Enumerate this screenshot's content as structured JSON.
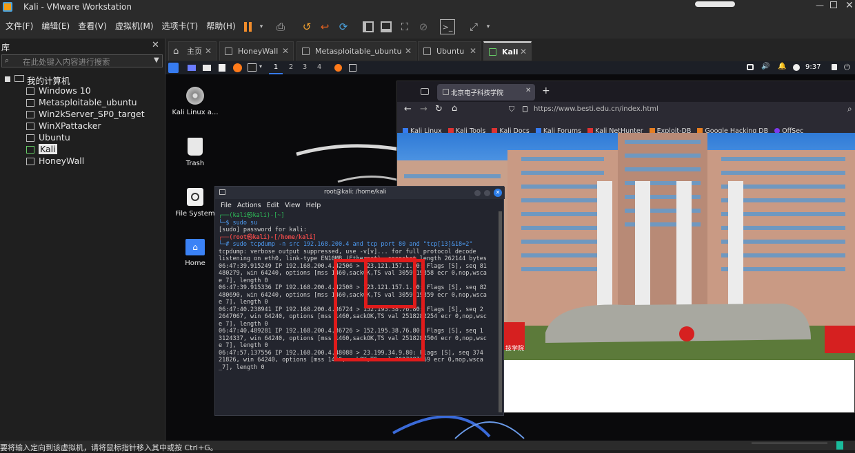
{
  "window": {
    "title": "Kali - VMware Workstation"
  },
  "menu": [
    "文件(F)",
    "编辑(E)",
    "查看(V)",
    "虚拟机(M)",
    "选项卡(T)",
    "帮助(H)"
  ],
  "library": {
    "title": "库",
    "search_placeholder": "在此处键入内容进行搜索",
    "root": "我的计算机",
    "items": [
      "Windows 10",
      "Metasploitable_ubuntu",
      "Win2kServer_SP0_target",
      "WinXPattacker",
      "Ubuntu",
      "Kali",
      "HoneyWall"
    ],
    "selected": "Kali"
  },
  "tabs": [
    {
      "label": "主页",
      "active": false
    },
    {
      "label": "HoneyWall",
      "active": false
    },
    {
      "label": "Metasploitable_ubuntu",
      "active": false
    },
    {
      "label": "Ubuntu",
      "active": false
    },
    {
      "label": "Kali",
      "active": true
    }
  ],
  "kali_panel": {
    "workspaces": [
      "1",
      "2",
      "3",
      "4"
    ],
    "clock": "9:37"
  },
  "desktop_icons": [
    "Kali Linux a...",
    "Trash",
    "File System",
    "Home"
  ],
  "browser": {
    "tab_title": "北京电子科技学院",
    "url": "https://www.besti.edu.cn/index.html",
    "bookmarks": [
      "Kali Linux",
      "Kali Tools",
      "Kali Docs",
      "Kali Forums",
      "Kali NetHunter",
      "Exploit-DB",
      "Google Hacking DB",
      "OffSec"
    ],
    "page_text": "技学院"
  },
  "terminal": {
    "title": "root@kali: /home/kali",
    "menu": [
      "File",
      "Actions",
      "Edit",
      "View",
      "Help"
    ],
    "prompt1": "┌──(kali㉿kali)-[~]",
    "cmd1": "└─$ sudo su",
    "sudo_line": "[sudo] password for kali:",
    "prompt2": "┌──(root㉿kali)-[/home/kali]",
    "cmd2": "└─# sudo tcpdump -n src 192.168.200.4 and tcp port 80 and \"tcp[13]&18=2\"",
    "output": [
      "tcpdump: verbose output suppressed, use -v[v]... for full protocol decode",
      "listening on eth0, link-type EN10MB (Ethernet), snapshot length 262144 bytes",
      "06:47:39.915249 IP 192.168.200.4.42506 > 123.121.157.1.80: Flags [S], seq 81",
      "480279, win 64240, options [mss 1460,sackOK,TS val 3059719358 ecr 0,nop,wsca",
      "e 7], length 0",
      "06:47:39.915336 IP 192.168.200.4.42508 > 123.121.157.1.80: Flags [S], seq 82",
      "480690, win 64240, options [mss 1460,sackOK,TS val 3059719359 ecr 0,nop,wsca",
      "e 7], length 0",
      "06:47:40.238941 IP 192.168.200.4.36724 > 152.195.38.76.80: Flags [S], seq 2",
      "2647067, win 64240, options [mss 1460,sackOK,TS val 2518282254 ecr 0,nop,wsc",
      "e 7], length 0",
      "06:47:40.489281 IP 192.168.200.4.36726 > 152.195.38.76.80: Flags [S], seq 1",
      "3124337, win 64240, options [mss 1460,sackOK,TS val 2518282504 ecr 0,nop,wsc",
      "e 7], length 0",
      "06:47:57.137556 IP 192.168.200.4.48088 > 23.199.34.9.80: Flags [S], seq 374",
      "21826, win 64240, options [mss 1460,sackOK,TS val 2097287769 ecr 0,nop,wsca",
      "_7], length 0"
    ]
  },
  "status": {
    "text": "要将输入定向到该虚拟机，请将鼠标指针移入其中或按 Ctrl+G。"
  },
  "colors": {
    "highlight": "#e01b1b",
    "kali_blue": "#367bf0",
    "selection": "#3a3a3a"
  }
}
